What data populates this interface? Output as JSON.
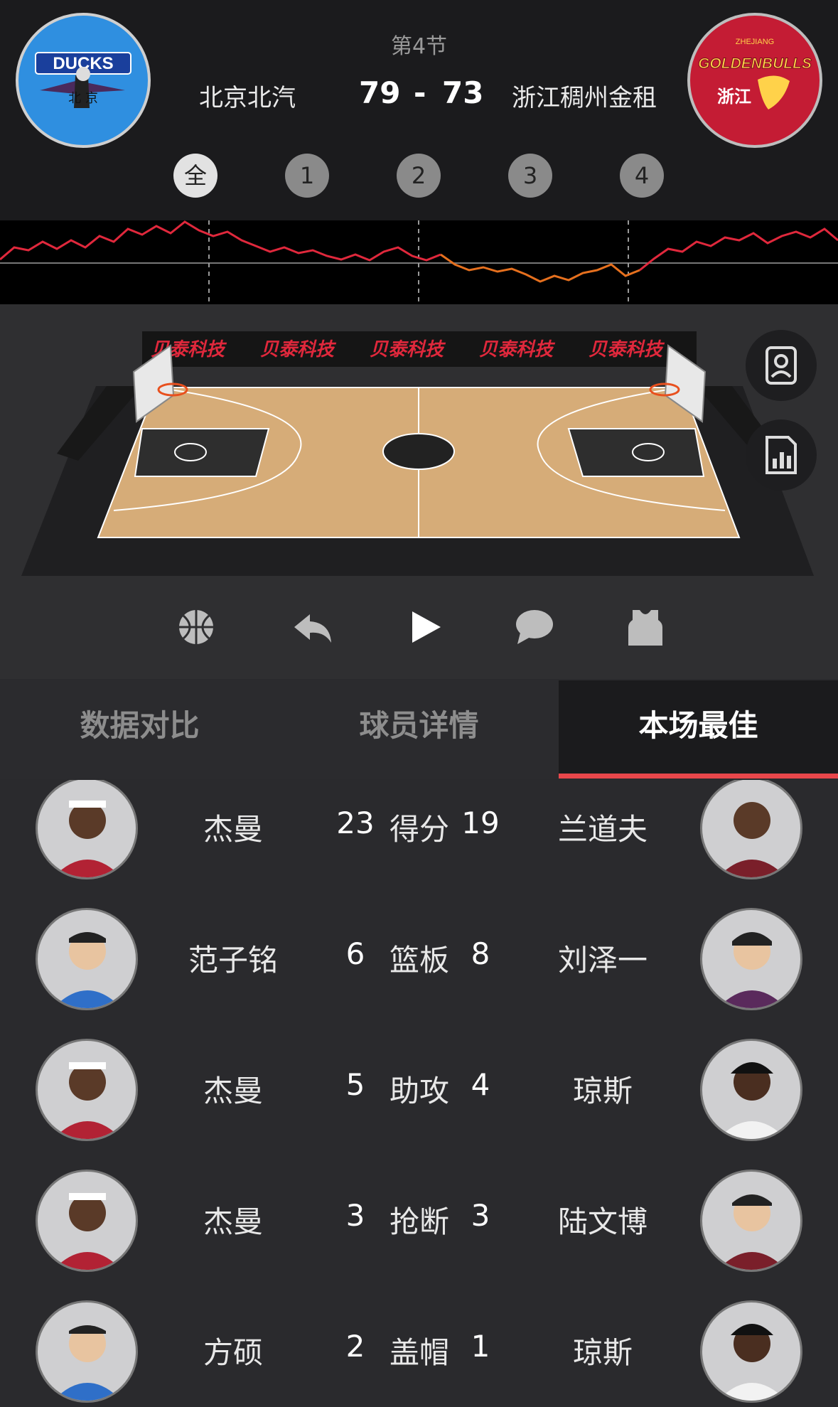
{
  "header": {
    "quarter": "第4节",
    "home_team": "北京北汽",
    "away_team": "浙江稠州金租",
    "home_score": "79",
    "separator": "-",
    "away_score": "73",
    "home_logo_text": "DUCKS",
    "home_logo_sub": "北  京",
    "away_logo_top": "ZHEJIANG",
    "away_logo_text": "GOLDENBULLS",
    "away_logo_sub": "浙江"
  },
  "periods": [
    "全",
    "1",
    "2",
    "3",
    "4"
  ],
  "court": {
    "banner": [
      "贝泰科技",
      "贝泰科技",
      "贝泰科技",
      "贝泰科技",
      "贝泰科技"
    ]
  },
  "tabs": [
    "数据对比",
    "球员详情",
    "本场最佳"
  ],
  "best": [
    {
      "home_player": "杰曼",
      "home_value": "23",
      "stat": "得分",
      "away_value": "19",
      "away_player": "兰道夫"
    },
    {
      "home_player": "范子铭",
      "home_value": "6",
      "stat": "篮板",
      "away_value": "8",
      "away_player": "刘泽一"
    },
    {
      "home_player": "杰曼",
      "home_value": "5",
      "stat": "助攻",
      "away_value": "4",
      "away_player": "琼斯"
    },
    {
      "home_player": "杰曼",
      "home_value": "3",
      "stat": "抢断",
      "away_value": "3",
      "away_player": "陆文博"
    },
    {
      "home_player": "方硕",
      "home_value": "2",
      "stat": "盖帽",
      "away_value": "1",
      "away_player": "琼斯"
    }
  ],
  "colors": {
    "accent": "#e8474b",
    "trend_lead": "#e0283c",
    "trend_trail": "#e6701e"
  }
}
